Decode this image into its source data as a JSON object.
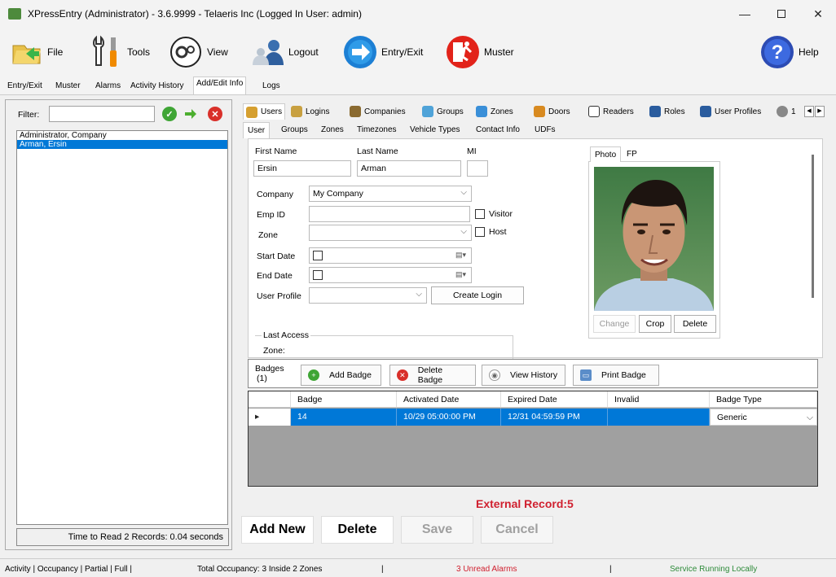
{
  "window": {
    "title": "XPressEntry (Administrator)  - 3.6.9999 - Telaeris Inc (Logged In User: admin)"
  },
  "menu": [
    {
      "label": "File",
      "icon": "folder-icon"
    },
    {
      "label": "Tools",
      "icon": "tools-icon"
    },
    {
      "label": "View",
      "icon": "gears-icon"
    },
    {
      "label": "Logout",
      "icon": "users-icon"
    },
    {
      "label": "Entry/Exit",
      "icon": "arrow-circle-icon"
    },
    {
      "label": "Muster",
      "icon": "exit-runner-icon"
    },
    {
      "label": "Help",
      "icon": "help-icon"
    }
  ],
  "main_tabs": [
    "Entry/Exit",
    "Muster",
    "Alarms",
    "Activity History",
    "Add/Edit Info",
    "Logs"
  ],
  "left": {
    "filter_label": "Filter:",
    "filter_value": "",
    "records": [
      "Administrator, Company",
      "Arman, Ersin"
    ],
    "time_to_read": "Time to Read 2 Records: 0.04 seconds"
  },
  "entity_tabs": [
    "Users",
    "Logins",
    "Companies",
    "Groups",
    "Zones",
    "Doors",
    "Readers",
    "Roles",
    "User Profiles",
    "1"
  ],
  "user_subtabs": [
    "User",
    "Groups",
    "Zones",
    "Timezones",
    "Vehicle Types",
    "Contact Info",
    "UDFs"
  ],
  "user": {
    "first_name_label": "First Name",
    "last_name_label": "Last Name",
    "mi_label": "MI",
    "first_name": "Ersin",
    "last_name": "Arman",
    "mi": "",
    "company_label": "Company",
    "company": "My Company",
    "emp_id_label": "Emp ID",
    "emp_id": "",
    "visitor_label": "Visitor",
    "zone_label": "Zone",
    "zone": "",
    "host_label": "Host",
    "start_date_label": "Start Date",
    "end_date_label": "End Date",
    "user_profile_label": "User Profile",
    "user_profile": "",
    "create_login_label": "Create Login",
    "last_access_label": "Last Access",
    "last_access_zone_label": "Zone:"
  },
  "photo": {
    "tabs": [
      "Photo",
      "FP"
    ],
    "change_label": "Change",
    "crop_label": "Crop",
    "delete_label": "Delete"
  },
  "badges": {
    "label": "Badges",
    "count": "(1)",
    "add_label": "Add Badge",
    "delete_label": "Delete Badge",
    "history_label": "View History",
    "print_label": "Print Badge",
    "columns": [
      "Badge",
      "Activated Date",
      "Expired Date",
      "Invalid",
      "Badge Type"
    ],
    "rows": [
      {
        "badge": "14",
        "activated": "10/29 05:00:00 PM",
        "expired": "12/31 04:59:59 PM",
        "invalid": "",
        "type": "Generic"
      }
    ]
  },
  "external_record": "External Record:5",
  "actions": {
    "add_new": "Add New",
    "delete": "Delete",
    "save": "Save",
    "cancel": "Cancel"
  },
  "status": {
    "links": "Activity | Occupancy | Partial | Full |",
    "occupancy": "Total Occupancy: 3 Inside 2 Zones",
    "sep1": "|",
    "alarms": "3 Unread Alarms",
    "sep2": "|",
    "service": "Service Running Locally"
  },
  "colors": {
    "accent": "#0078d7",
    "alarm": "#d0202f",
    "service": "#2e8b3a"
  }
}
